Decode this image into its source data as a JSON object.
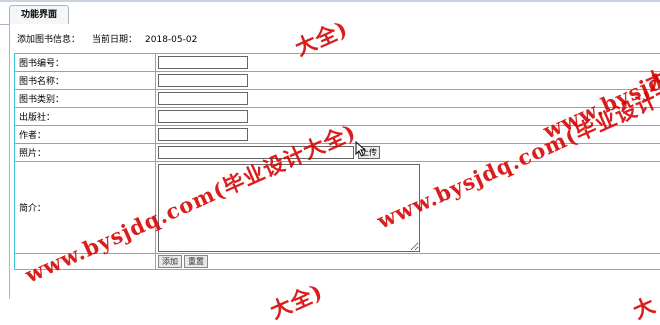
{
  "tab": {
    "title": "功能界面"
  },
  "info": {
    "heading": "添加图书信息：",
    "date_label": "当前日期：",
    "date_value": "2018-05-02"
  },
  "form": {
    "fields": [
      {
        "label": "图书编号：",
        "value": ""
      },
      {
        "label": "图书名称：",
        "value": ""
      },
      {
        "label": "图书类别：",
        "value": ""
      },
      {
        "label": "出版社：",
        "value": ""
      },
      {
        "label": "作者：",
        "value": ""
      }
    ],
    "photo": {
      "label": "照片：",
      "value": "",
      "upload_label": "上传"
    },
    "intro": {
      "label": "简介：",
      "value": ""
    },
    "buttons": {
      "add": "添加",
      "reset": "重置"
    }
  },
  "watermark": {
    "text": "www.bysjdq.com(毕业设计大全)",
    "fragment_top": "大全)",
    "fragment_bottom_left": "大全)",
    "fragment_bottom_right": "大",
    "color": "#d60000"
  }
}
